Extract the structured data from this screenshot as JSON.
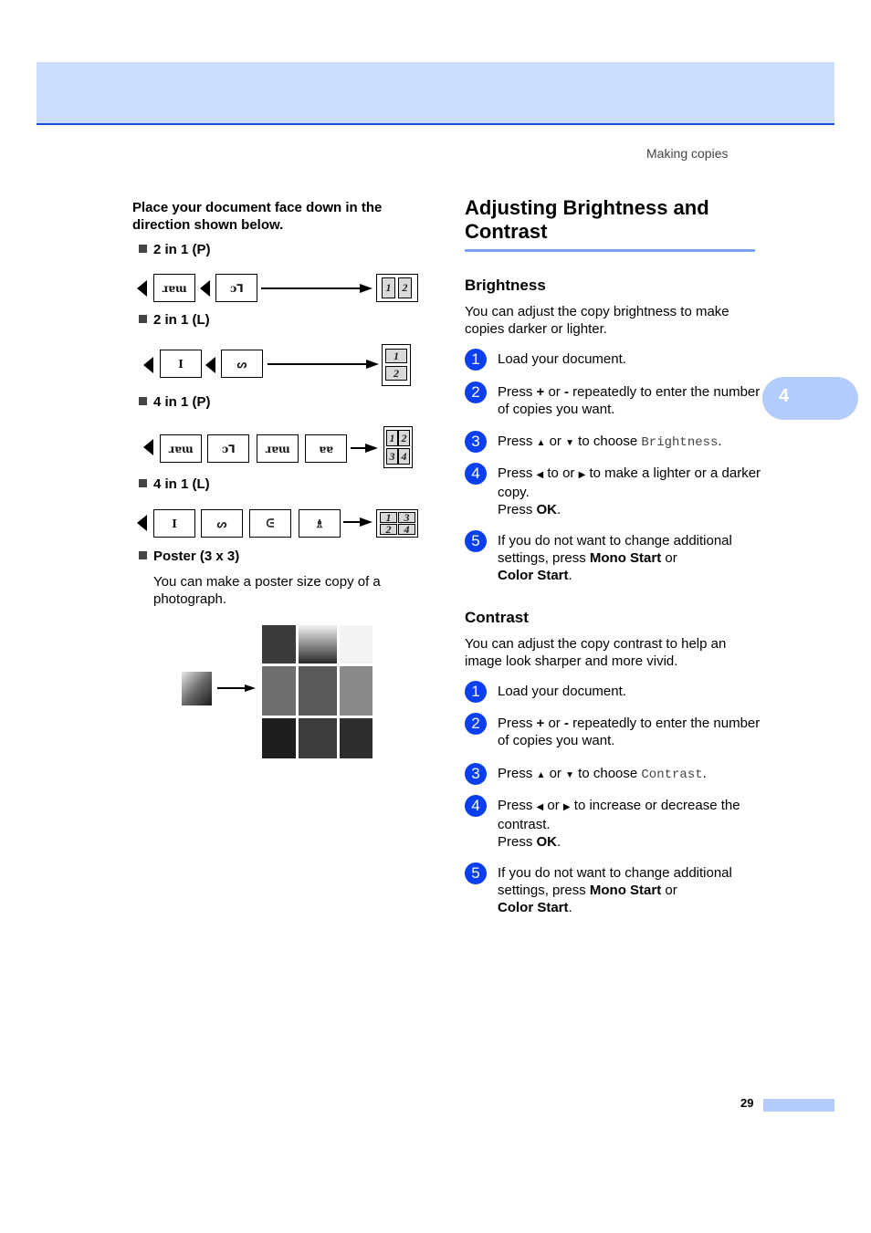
{
  "header": {
    "running_head": "Making copies",
    "chapter_tab": "4",
    "page_number": "29"
  },
  "left": {
    "intro": "Place your document face down in the direction shown below.",
    "layouts": [
      {
        "label": "2 in 1 (P)",
        "result_cells": [
          "1",
          "2"
        ]
      },
      {
        "label": "2 in 1 (L)",
        "result_cells": [
          "1",
          "2"
        ]
      },
      {
        "label": "4 in 1 (P)",
        "result_cells": [
          "1",
          "2",
          "3",
          "4"
        ]
      },
      {
        "label": "4 in 1 (L)",
        "result_cells": [
          "1",
          "3",
          "2",
          "4"
        ]
      }
    ],
    "poster": {
      "label": "Poster (3 x 3)",
      "description": "You can make a poster size copy of a photograph."
    }
  },
  "right": {
    "title": "Adjusting Brightness and Contrast",
    "brightness": {
      "heading": "Brightness",
      "intro": "You can adjust the copy brightness to make copies darker or lighter.",
      "steps": [
        {
          "num": "1",
          "text": "Load your document."
        },
        {
          "num": "2",
          "pre": "Press ",
          "b1": "+",
          "mid": " or ",
          "b2": "-",
          "post": " repeatedly to enter the number of copies you want."
        },
        {
          "num": "3",
          "pre": "Press ",
          "up": "▲",
          "mid": " or ",
          "down": "▼",
          "post": " to choose ",
          "mono": "Brightness",
          "end": "."
        },
        {
          "num": "4",
          "pre": "Press ",
          "left": "◀",
          "mid": " to or ",
          "right": "▶",
          "post": " to make a lighter or a darker copy.",
          "line2": "Press ",
          "ok": "OK",
          "end": "."
        },
        {
          "num": "5",
          "pre": "If you do not want to change additional settings, press ",
          "b1": "Mono Start",
          "mid": " or ",
          "b2": "Color Start",
          "end": "."
        }
      ]
    },
    "contrast": {
      "heading": "Contrast",
      "intro": "You can adjust the copy contrast to help an image look sharper and more vivid.",
      "steps": [
        {
          "num": "1",
          "text": "Load your document."
        },
        {
          "num": "2",
          "pre": "Press ",
          "b1": "+",
          "mid": " or ",
          "b2": "-",
          "post": " repeatedly to enter the number of copies you want."
        },
        {
          "num": "3",
          "pre": "Press ",
          "up": "▲",
          "mid": " or ",
          "down": "▼",
          "post": " to choose ",
          "mono": "Contrast",
          "end": "."
        },
        {
          "num": "4",
          "pre": "Press ",
          "left": "◀",
          "mid": " or ",
          "right": "▶",
          "post": " to increase or decrease the contrast.",
          "line2": "Press ",
          "ok": "OK",
          "end": "."
        },
        {
          "num": "5",
          "pre": "If you do not want to change additional settings, press ",
          "b1": "Mono Start",
          "mid": " or ",
          "b2": "Color Start",
          "end": "."
        }
      ]
    }
  },
  "colors": {
    "header_band": "#cbdcfd",
    "header_rule": "#1a4fd8",
    "tab": "#b3ccfb",
    "step_circle": "#0a3ff0",
    "title_rule": "#7aa2f4"
  }
}
